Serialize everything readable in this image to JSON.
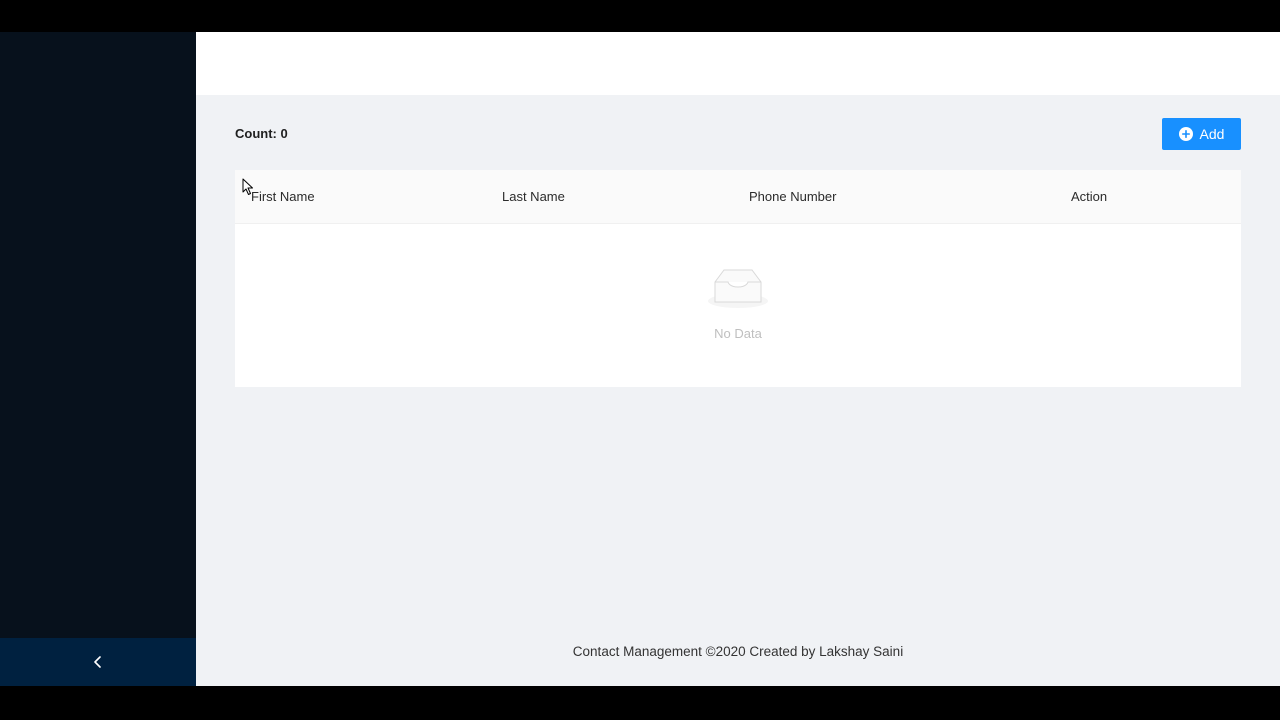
{
  "toolbar": {
    "count_label": "Count: 0",
    "add_label": "Add"
  },
  "table": {
    "columns": [
      "First Name",
      "Last Name",
      "Phone Number",
      "Action"
    ],
    "rows": [],
    "empty_text": "No Data"
  },
  "footer": {
    "text": "Contact Management ©2020 Created by Lakshay Saini"
  },
  "icons": {
    "sider_trigger": "chevron-left-icon",
    "add": "plus-circle-icon",
    "empty": "inbox-icon"
  },
  "colors": {
    "sider": "#001529",
    "sider_trigger": "#002140",
    "primary": "#1890ff",
    "background": "#f0f2f5"
  }
}
